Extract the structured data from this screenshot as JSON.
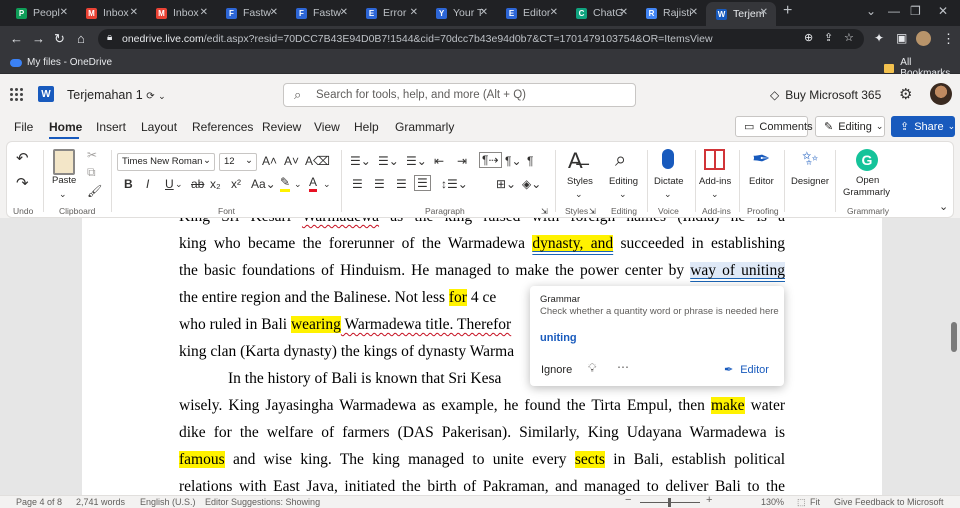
{
  "browser": {
    "tabs": [
      {
        "label": "Peopl",
        "favicon": "P",
        "color": "#0f9d58"
      },
      {
        "label": "Inbox",
        "favicon": "M",
        "color": "#ea4335"
      },
      {
        "label": "Inbox",
        "favicon": "M",
        "color": "#ea4335"
      },
      {
        "label": "Fastw",
        "favicon": "F",
        "color": "#2d66d6"
      },
      {
        "label": "Fastw",
        "favicon": "F",
        "color": "#2d66d6"
      },
      {
        "label": "Error",
        "favicon": "E",
        "color": "#2d66d6"
      },
      {
        "label": "Your T",
        "favicon": "Y",
        "color": "#2d66d6"
      },
      {
        "label": "Editor",
        "favicon": "E",
        "color": "#2d66d6"
      },
      {
        "label": "ChatG",
        "favicon": "C",
        "color": "#10a37f"
      },
      {
        "label": "Rajisti",
        "favicon": "R",
        "color": "#4285f4"
      },
      {
        "label": "Terjem",
        "favicon": "W",
        "color": "#185abd"
      }
    ],
    "url_host": "onedrive.live.com",
    "url_path": "/edit.aspx?resid=70DCC7B43E94D0B7!1544&cid=70dcc7b43e94d0b7&CT=1701479103754&OR=ItemsView",
    "bookmark_onedrive": "My files - OneDrive",
    "bookmark_all": "All Bookmarks"
  },
  "word": {
    "doc_title": "Terjemahan 1",
    "search_placeholder": "Search for tools, help, and more (Alt + Q)",
    "buy": "Buy Microsoft 365"
  },
  "ribbon_tabs": [
    "File",
    "Home",
    "Insert",
    "Layout",
    "References",
    "Review",
    "View",
    "Help",
    "Grammarly"
  ],
  "header_buttons": {
    "comments": "Comments",
    "editing": "Editing",
    "share": "Share"
  },
  "ribbon": {
    "font_name": "Times New Roman",
    "font_size": "12",
    "groups": {
      "undo": "Undo",
      "clipboard": "Clipboard",
      "font": "Font",
      "paragraph": "Paragraph",
      "styles": "Styles",
      "editing": "Editing",
      "voice": "Voice",
      "addins": "Add-ins",
      "proofing": "Proofing",
      "grammarly": "Grammarly"
    },
    "buttons": {
      "paste": "Paste",
      "styles": "Styles",
      "editing": "Editing",
      "dictate": "Dictate",
      "addins": "Add-ins",
      "editor": "Editor",
      "designer": "Designer",
      "open_grammarly_1": "Open",
      "open_grammarly_2": "Grammarly"
    }
  },
  "document": {
    "line0": "King Sri Kesari Warmadewa as the king raised with foreign names (India) he is a",
    "line1a": "king who became the forerunner of the Warmadewa ",
    "line1b": "dynasty, and",
    "line1c": " succeeded in establishing",
    "line2a": "the basic foundations of Hinduism. He managed to make the power center by ",
    "line2b": "way of uniting",
    "line3a": "the entire region and the Balinese. Not less ",
    "line3b": "for",
    "line3c": " 4 ce",
    "line4a": "who ruled in Bali ",
    "line4b": "wearing",
    "line4c": " Warmadewa title. Therefor",
    "line5a": "king clan (Karta dynasty) the kings of dynasty Warma",
    "line6": "In the history of Bali is known that Sri Kesa",
    "line7a": "wisely. King Jayasingha Warmadewa as example, he found the Tirta Empul, then ",
    "line7b": "make",
    "line7c": " water",
    "line8": "dike for the welfare of farmers (DAS Pakerisan). Similarly, King Udayana Warmadewa is",
    "line9a": "famous",
    "line9b": " and wise king. The king managed to unite every ",
    "line9c": "sects",
    "line9d": " in Bali, establish political",
    "line10": "relations with East Java, initiated the birth of Pakraman, and managed to deliver Bali to the"
  },
  "popup": {
    "title": "Grammar",
    "description": "Check whether a quantity word or phrase is needed here",
    "suggestion": "uniting",
    "ignore": "Ignore",
    "editor": "Editor"
  },
  "status": {
    "page": "Page 4 of 8",
    "words": "2,741 words",
    "language": "English (U.S.)",
    "suggestions": "Editor Suggestions: Showing",
    "zoom": "130%",
    "fit": "Fit",
    "feedback": "Give Feedback to Microsoft"
  }
}
